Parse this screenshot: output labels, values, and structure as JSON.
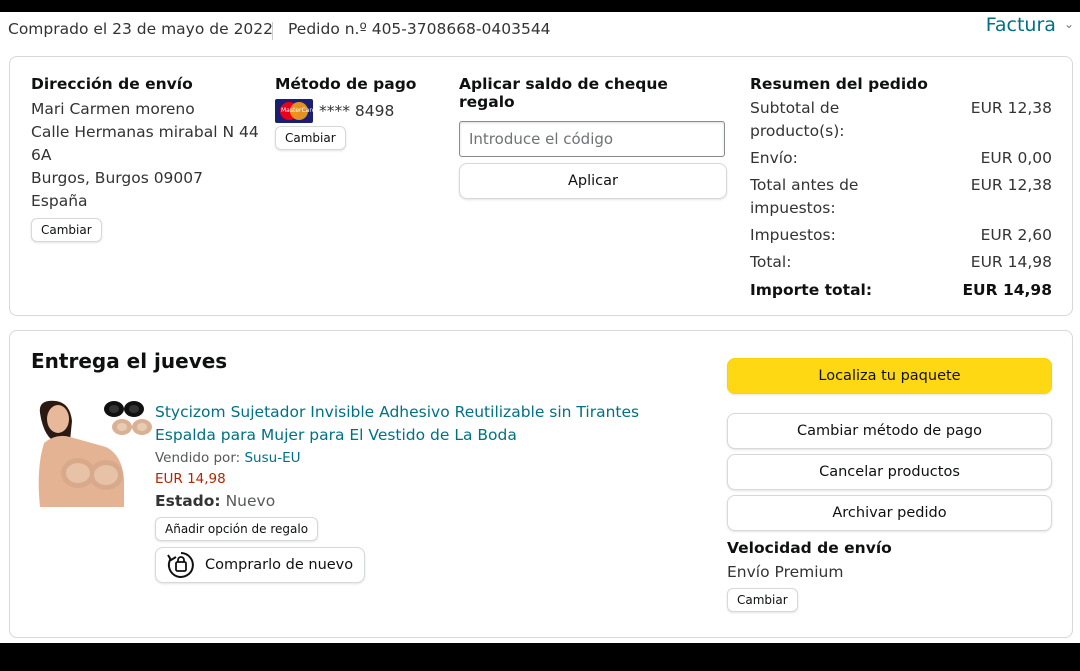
{
  "header": {
    "purchased": "Comprado el 23 de mayo de 2022",
    "order_number": "Pedido n.º 405-3708668-0403544",
    "invoice": "Factura"
  },
  "shipping": {
    "heading": "Dirección de envío",
    "lines": [
      "Mari Carmen moreno",
      "Calle Hermanas mirabal N 44",
      "6A",
      "Burgos, Burgos 09007",
      "España"
    ],
    "change": "Cambiar"
  },
  "payment": {
    "heading": "Método de pago",
    "card_brand_icon": "mastercard-icon",
    "card_masked": "**** 8498",
    "change": "Cambiar"
  },
  "gift_card": {
    "heading": "Aplicar saldo de cheque regalo",
    "placeholder": "Introduce el código",
    "apply": "Aplicar"
  },
  "summary": {
    "heading": "Resumen del pedido",
    "rows": [
      {
        "label": "Subtotal de producto(s):",
        "value": "EUR 12,38"
      },
      {
        "label": "Envío:",
        "value": "EUR 0,00"
      },
      {
        "label": "Total antes de impuestos:",
        "value": "EUR 12,38"
      },
      {
        "label": "Impuestos:",
        "value": "EUR 2,60"
      },
      {
        "label": "Total:",
        "value": "EUR 14,98"
      }
    ],
    "grand_total": {
      "label": "Importe total:",
      "value": "EUR 14,98"
    }
  },
  "delivery": {
    "title": "Entrega el jueves",
    "product": {
      "title": "Stycizom Sujetador Invisible Adhesivo Reutilizable sin Tirantes Espalda para Mujer para El Vestido de La Boda",
      "sold_by_label": "Vendido por:",
      "seller": "Susu-EU",
      "price": "EUR 14,98",
      "status_label": "Estado:",
      "status_value": "Nuevo",
      "gift_option": "Añadir opción de regalo",
      "buy_again": "Comprarlo de nuevo"
    },
    "actions": {
      "track": "Localiza tu paquete",
      "change_payment": "Cambiar método de pago",
      "cancel": "Cancelar productos",
      "archive": "Archivar pedido"
    },
    "speed": {
      "heading": "Velocidad de envío",
      "value": "Envío Premium",
      "change": "Cambiar"
    }
  },
  "colors": {
    "link": "#007185",
    "primary_button": "#FFD814",
    "price": "#B12704"
  }
}
